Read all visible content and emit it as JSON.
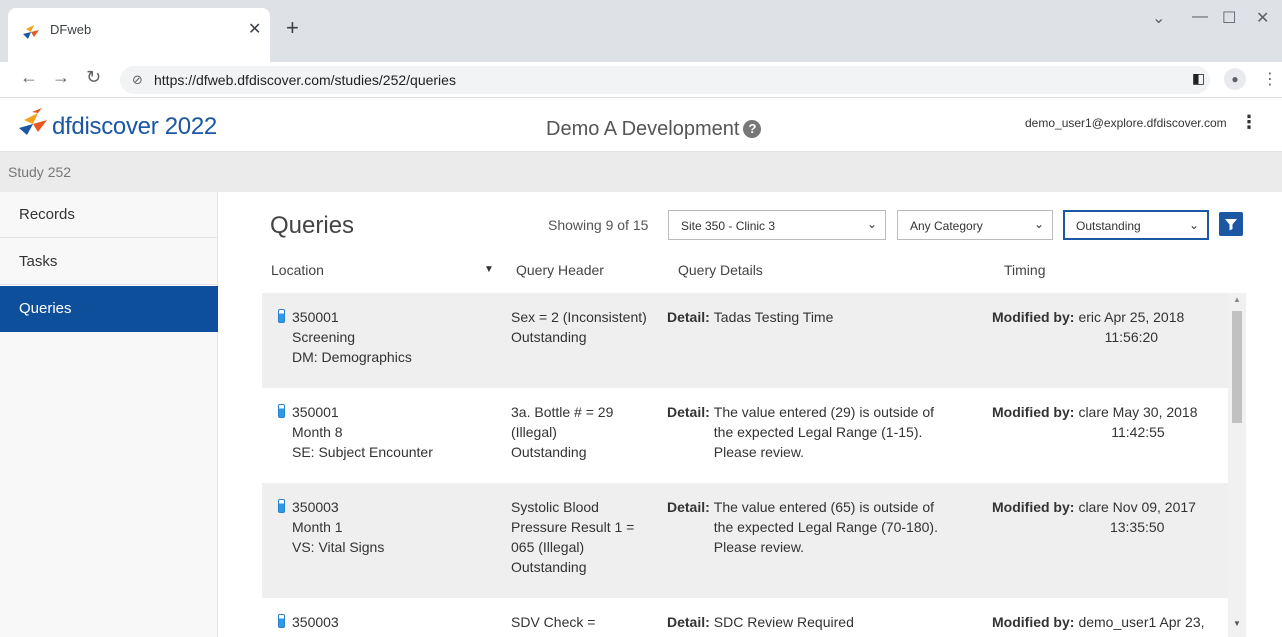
{
  "browser": {
    "tab_title": "DFweb",
    "url": "https://dfweb.dfdiscover.com/studies/252/queries"
  },
  "header": {
    "logo_text": "dfdiscover 2022",
    "study_title": "Demo A Development",
    "user_email": "demo_user1@explore.dfdiscover.com"
  },
  "studybar": {
    "label": "Study 252"
  },
  "sidebar": {
    "items": [
      {
        "label": "Records"
      },
      {
        "label": "Tasks"
      },
      {
        "label": "Queries"
      }
    ]
  },
  "main": {
    "title": "Queries",
    "showing": "Showing 9 of 15",
    "filters": {
      "site": "Site 350 - Clinic 3",
      "category": "Any Category",
      "status": "Outstanding"
    },
    "columns": [
      "Location",
      "Query Header",
      "Query Details",
      "Timing"
    ],
    "rows": [
      {
        "loc": [
          "350001",
          "Screening",
          "DM: Demographics"
        ],
        "hdr": [
          "Sex = 2 (Inconsistent)",
          "Outstanding"
        ],
        "det_label": "Detail:",
        "det": [
          "Tadas Testing Time"
        ],
        "tim_label": "Modified by:",
        "tim": [
          "eric Apr 25, 2018",
          "11:56:20"
        ]
      },
      {
        "loc": [
          "350001",
          "Month 8",
          "SE: Subject Encounter"
        ],
        "hdr": [
          "3a. Bottle # = 29",
          "(Illegal)",
          "Outstanding"
        ],
        "det_label": "Detail:",
        "det": [
          "The value entered (29) is outside of",
          "the expected Legal Range (1-15).",
          "Please review."
        ],
        "tim_label": "Modified by:",
        "tim": [
          "clare May 30, 2018",
          "11:42:55"
        ]
      },
      {
        "loc": [
          "350003",
          "Month 1",
          "VS: Vital Signs"
        ],
        "hdr": [
          "Systolic Blood",
          "Pressure Result 1 =",
          "065 (Illegal)",
          "Outstanding"
        ],
        "det_label": "Detail:",
        "det": [
          "The value entered (65) is outside of",
          "the expected Legal Range (70-180).",
          "Please review."
        ],
        "tim_label": "Modified by:",
        "tim": [
          "clare Nov 09, 2017",
          "13:35:50"
        ]
      },
      {
        "loc": [
          "350003",
          "",
          ""
        ],
        "hdr": [
          "SDV Check =",
          ""
        ],
        "det_label": "Detail:",
        "det": [
          "SDC Review Required"
        ],
        "tim_label": "Modified by:",
        "tim": [
          "demo_user1 Apr 23,",
          ""
        ]
      }
    ]
  }
}
